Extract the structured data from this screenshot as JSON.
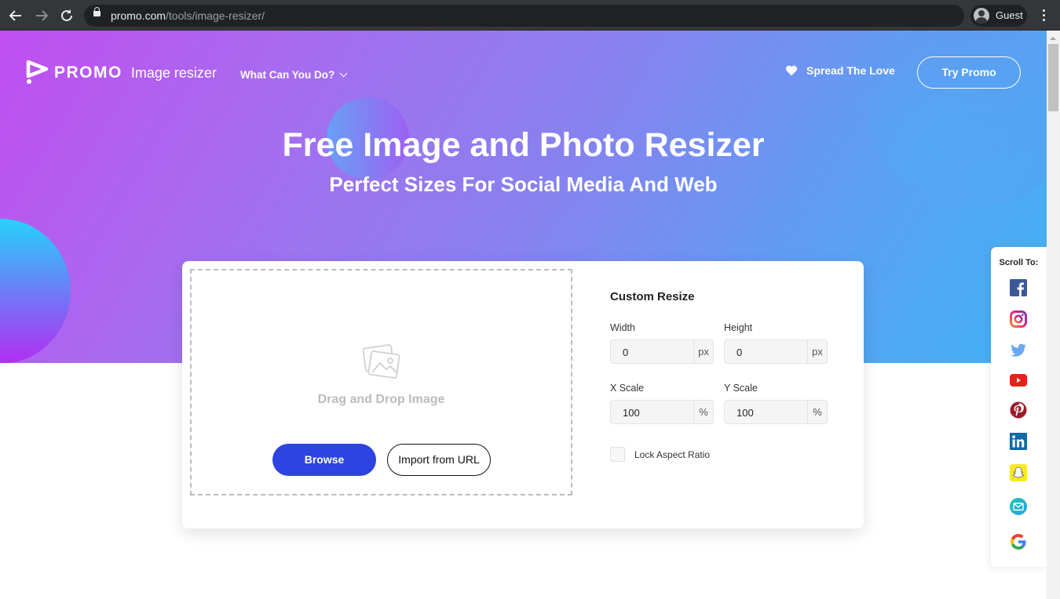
{
  "browser": {
    "url_host": "promo.com",
    "url_path": "/tools/image-resizer/",
    "profile_name": "Guest",
    "icons": [
      "back-arrow-icon",
      "forward-arrow-icon",
      "reload-icon",
      "lock-icon",
      "profile-avatar-icon",
      "more-vert-icon"
    ]
  },
  "header": {
    "logo_text": "PROMO",
    "product_name": "Image resizer",
    "nav_menu_label": "What Can You Do?",
    "spread_label": "Spread The Love",
    "try_button": "Try Promo"
  },
  "hero": {
    "title": "Free Image and Photo Resizer",
    "subtitle": "Perfect Sizes For Social Media And Web"
  },
  "upload": {
    "dropzone_text": "Drag and Drop Image",
    "browse_button": "Browse",
    "import_button": "Import from URL"
  },
  "custom_resize": {
    "title": "Custom Resize",
    "width": {
      "label": "Width",
      "value": "0",
      "unit": "px"
    },
    "height": {
      "label": "Height",
      "value": "0",
      "unit": "px"
    },
    "x_scale": {
      "label": "X Scale",
      "value": "100",
      "unit": "%"
    },
    "y_scale": {
      "label": "Y Scale",
      "value": "100",
      "unit": "%"
    },
    "lock_aspect_label": "Lock Aspect Ratio",
    "lock_aspect_checked": false
  },
  "scroll_to": {
    "title": "Scroll To:",
    "items": [
      "facebook",
      "instagram",
      "twitter",
      "youtube",
      "pinterest",
      "linkedin",
      "snapchat",
      "email",
      "google"
    ]
  },
  "colors": {
    "browse_blue": "#2c44e0",
    "hero_gradient_start": "#c04ef0",
    "hero_gradient_end": "#3fb3f5"
  }
}
